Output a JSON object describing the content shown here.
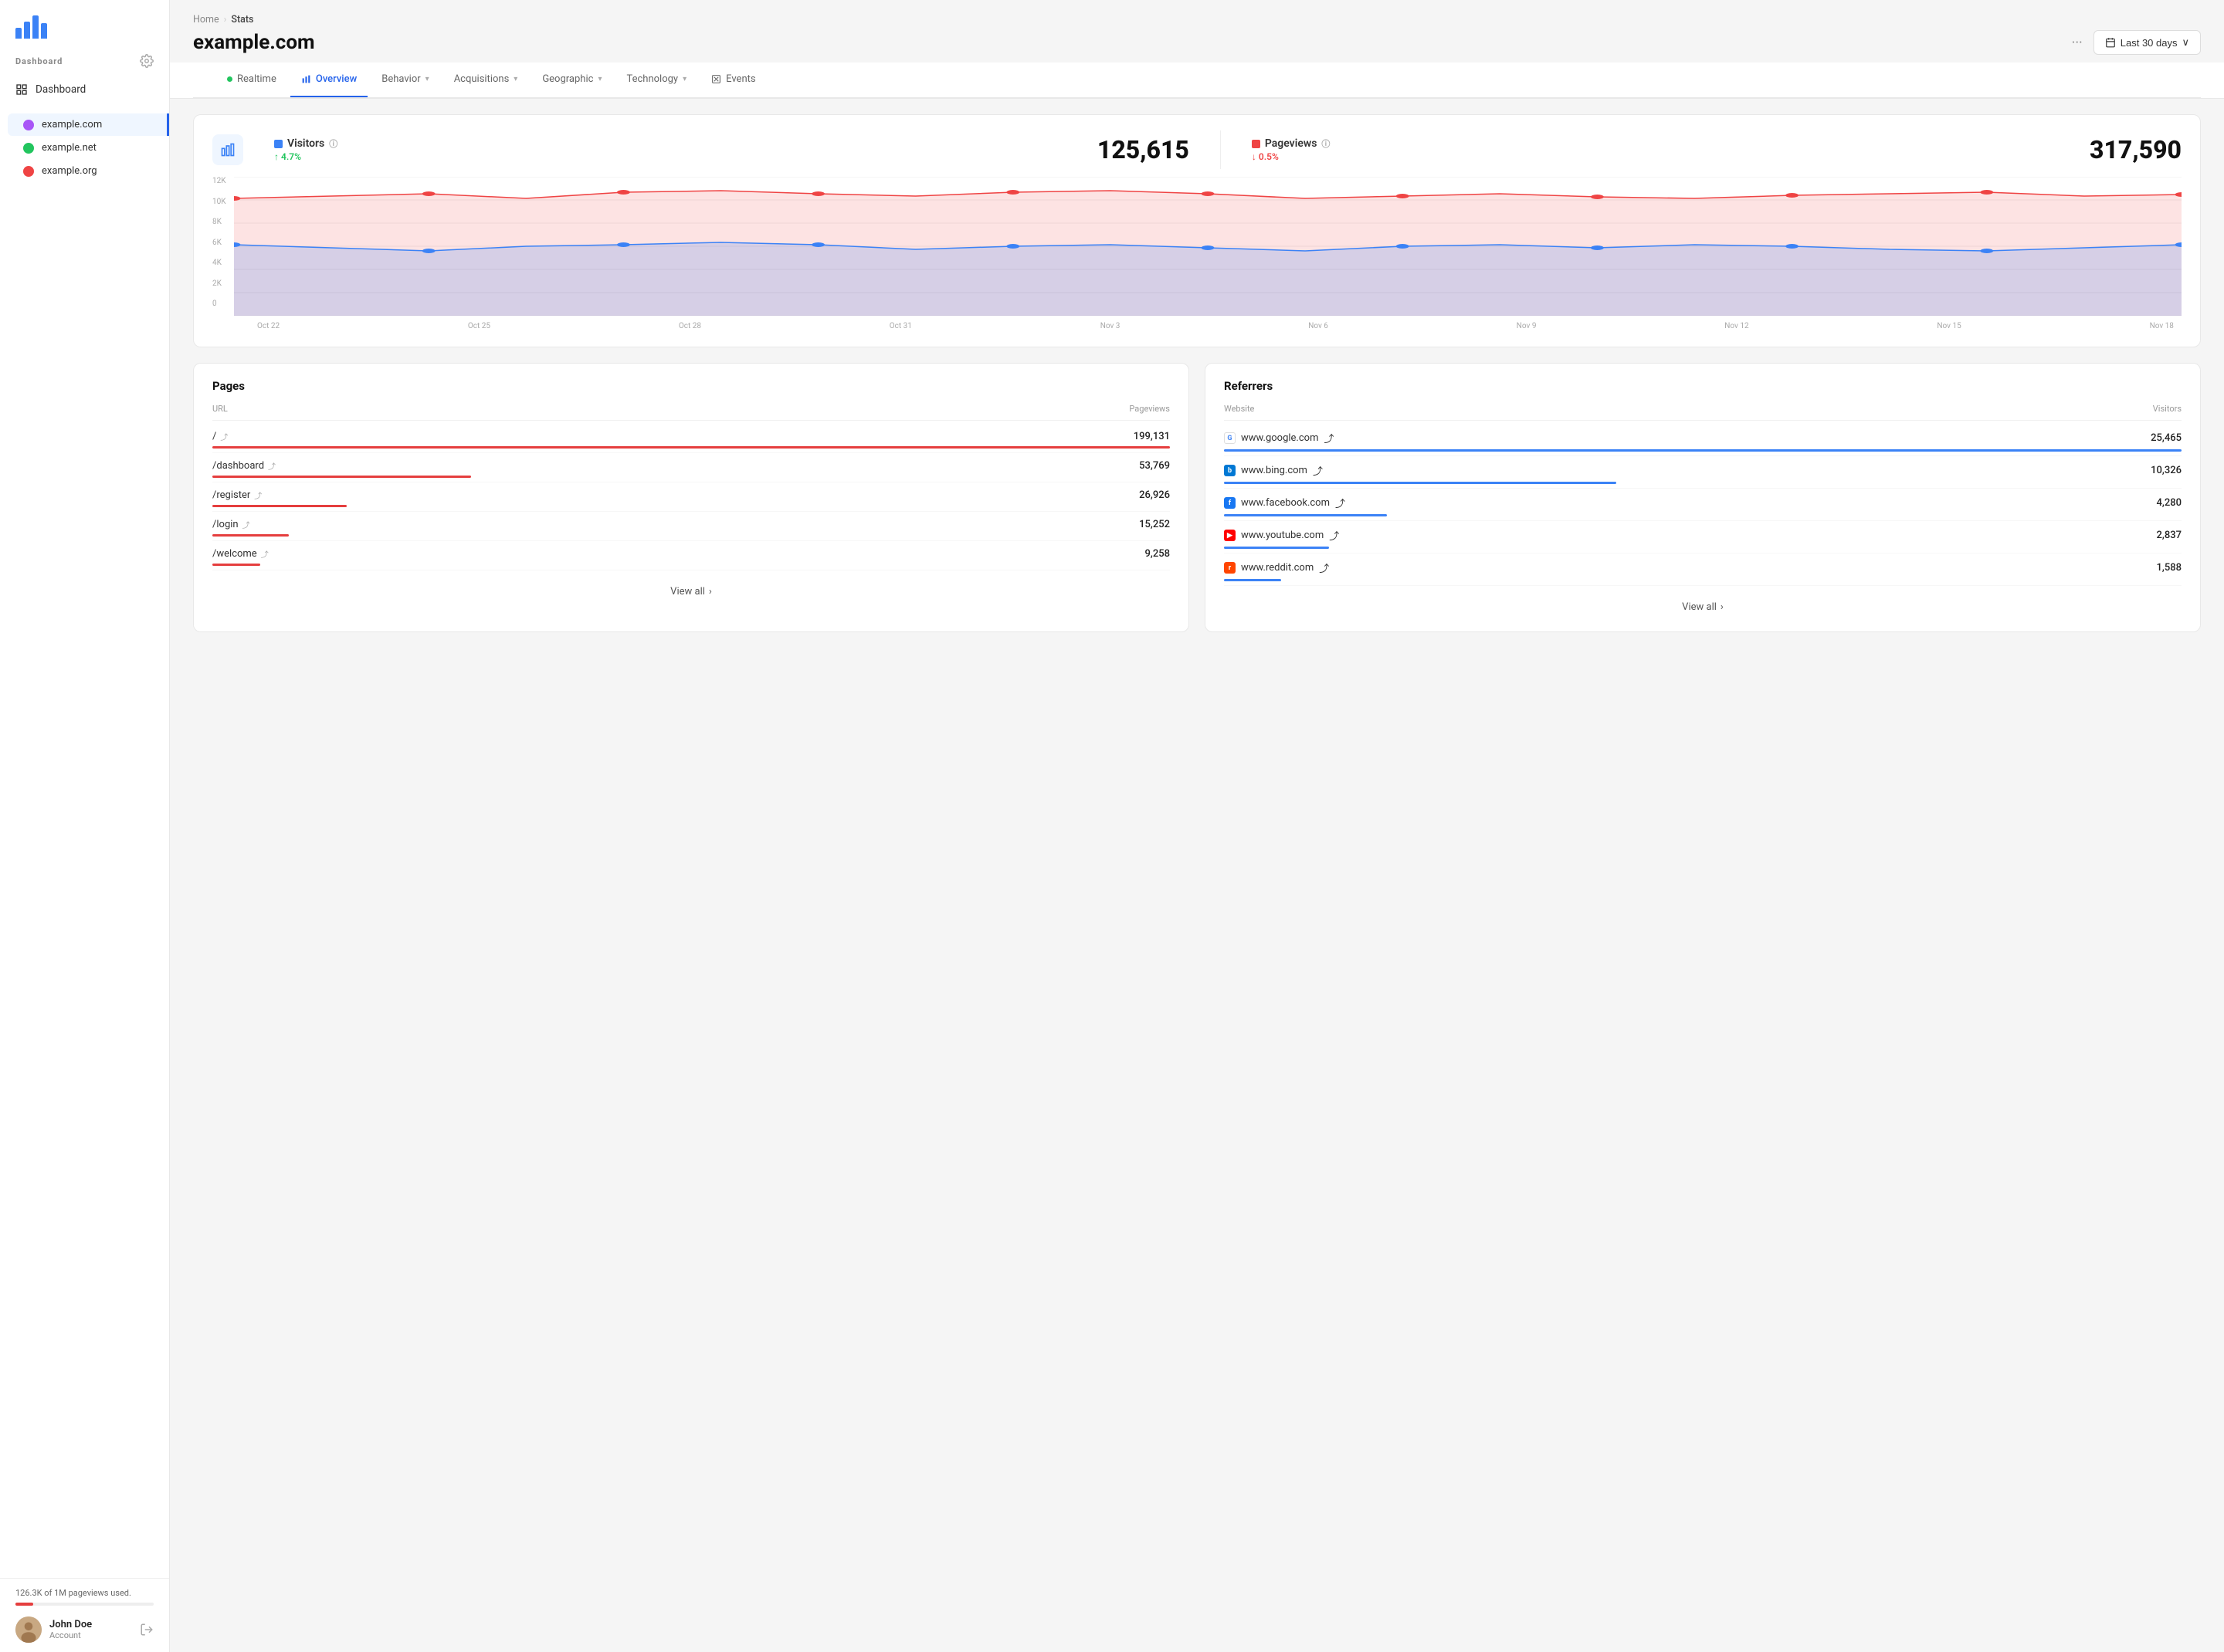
{
  "sidebar": {
    "nav": [
      {
        "id": "dashboard",
        "label": "Dashboard",
        "icon": "grid"
      }
    ],
    "sites": [
      {
        "id": "example-com",
        "label": "example.com",
        "color": "#a855f7",
        "active": true
      },
      {
        "id": "example-net",
        "label": "example.net",
        "color": "#22c55e"
      },
      {
        "id": "example-org",
        "label": "example.org",
        "color": "#ef4444"
      }
    ],
    "usage": {
      "text": "126.3K of 1M pageviews used.",
      "percent": 12.6
    },
    "user": {
      "name": "John Doe",
      "role": "Account"
    }
  },
  "breadcrumb": {
    "home": "Home",
    "current": "Stats"
  },
  "page": {
    "title": "example.com",
    "date_range": "Last 30 days",
    "dots": "···"
  },
  "tabs": [
    {
      "id": "realtime",
      "label": "Realtime",
      "type": "dot"
    },
    {
      "id": "overview",
      "label": "Overview",
      "type": "icon",
      "active": true
    },
    {
      "id": "behavior",
      "label": "Behavior",
      "type": "chevron"
    },
    {
      "id": "acquisitions",
      "label": "Acquisitions",
      "type": "chevron"
    },
    {
      "id": "geographic",
      "label": "Geographic",
      "type": "chevron"
    },
    {
      "id": "technology",
      "label": "Technology",
      "type": "chevron"
    },
    {
      "id": "events",
      "label": "Events",
      "type": "icon"
    }
  ],
  "metrics": {
    "visitors": {
      "label": "Visitors",
      "value": "125,615",
      "change": "4.7%",
      "change_dir": "up",
      "color": "#3b82f6"
    },
    "pageviews": {
      "label": "Pageviews",
      "value": "317,590",
      "change": "0.5%",
      "change_dir": "down",
      "color": "#ef4444"
    }
  },
  "chart": {
    "x_labels": [
      "Oct 22",
      "Oct 25",
      "Oct 28",
      "Oct 31",
      "Nov 3",
      "Nov 6",
      "Nov 9",
      "Nov 12",
      "Nov 15",
      "Nov 18"
    ],
    "y_labels": [
      "12K",
      "10K",
      "8K",
      "6K",
      "4K",
      "2K",
      "0"
    ]
  },
  "pages_table": {
    "title": "Pages",
    "col1": "URL",
    "col2": "Pageviews",
    "rows": [
      {
        "url": "/",
        "value": "199,131",
        "bar_pct": 100
      },
      {
        "url": "/dashboard",
        "value": "53,769",
        "bar_pct": 27
      },
      {
        "url": "/register",
        "value": "26,926",
        "bar_pct": 14
      },
      {
        "url": "/login",
        "value": "15,252",
        "bar_pct": 8
      },
      {
        "url": "/welcome",
        "value": "9,258",
        "bar_pct": 5
      }
    ],
    "view_all": "View all"
  },
  "referrers_table": {
    "title": "Referrers",
    "col1": "Website",
    "col2": "Visitors",
    "rows": [
      {
        "site": "www.google.com",
        "value": "25,465",
        "bar_pct": 100,
        "favicon_type": "google"
      },
      {
        "site": "www.bing.com",
        "value": "10,326",
        "bar_pct": 41,
        "favicon_type": "bing"
      },
      {
        "site": "www.facebook.com",
        "value": "4,280",
        "bar_pct": 17,
        "favicon_type": "facebook"
      },
      {
        "site": "www.youtube.com",
        "value": "2,837",
        "bar_pct": 11,
        "favicon_type": "youtube"
      },
      {
        "site": "www.reddit.com",
        "value": "1,588",
        "bar_pct": 6,
        "favicon_type": "reddit"
      }
    ],
    "view_all": "View all"
  }
}
